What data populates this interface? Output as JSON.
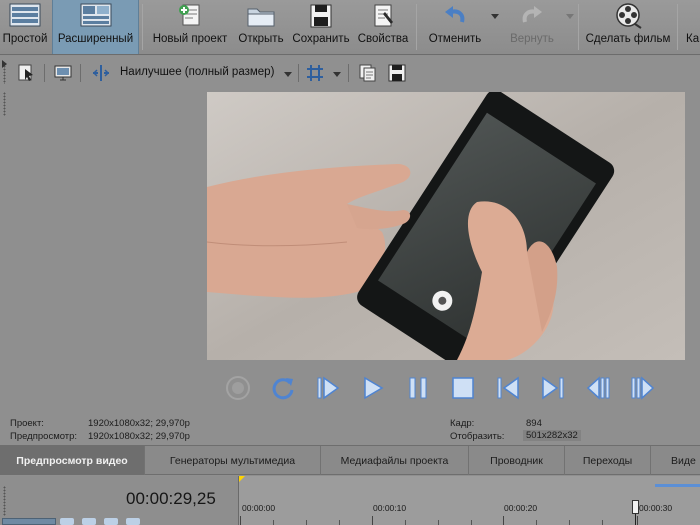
{
  "toolbar": {
    "buttons": [
      {
        "label": "Простой",
        "icon": "simple-mode-icon"
      },
      {
        "label": "Расширенный",
        "icon": "advanced-mode-icon"
      },
      {
        "label": "Новый проект",
        "icon": "new-project-icon"
      },
      {
        "label": "Открыть",
        "icon": "folder-icon"
      },
      {
        "label": "Сохранить",
        "icon": "save-icon"
      },
      {
        "label": "Свойства",
        "icon": "properties-icon"
      },
      {
        "label": "Отменить",
        "icon": "undo-icon"
      },
      {
        "label": "Вернуть",
        "icon": "redo-icon"
      },
      {
        "label": "Сделать фильм",
        "icon": "film-reel-icon"
      },
      {
        "label": "Ка",
        "icon": ""
      }
    ],
    "active_index": 1
  },
  "subbar": {
    "quality_label": "Наилучшее (полный размер)"
  },
  "info": {
    "project_label": "Проект:",
    "project_value": "1920x1080x32; 29,970p",
    "preview_label": "Предпросмотр:",
    "preview_value": "1920x1080x32; 29,970p",
    "frame_label": "Кадр:",
    "frame_value": "894",
    "display_label": "Отобразить:",
    "display_value": "501x282x32"
  },
  "tabs": [
    {
      "label": "Предпросмотр видео",
      "active": true
    },
    {
      "label": "Генераторы мультимедиа",
      "active": false
    },
    {
      "label": "Медиафайлы проекта",
      "active": false
    },
    {
      "label": "Проводник",
      "active": false
    },
    {
      "label": "Переходы",
      "active": false
    },
    {
      "label": "Виде",
      "active": false
    }
  ],
  "timeline": {
    "timecode": "00:00:29,25",
    "ruler_labels": [
      "00:00:00",
      "00:00:10",
      "00:00:20",
      "00:00:30"
    ]
  },
  "colors": {
    "accent_active": "#7a9bb4",
    "background": "#8f8f8f",
    "transport_blue": "#5b8fd6"
  }
}
